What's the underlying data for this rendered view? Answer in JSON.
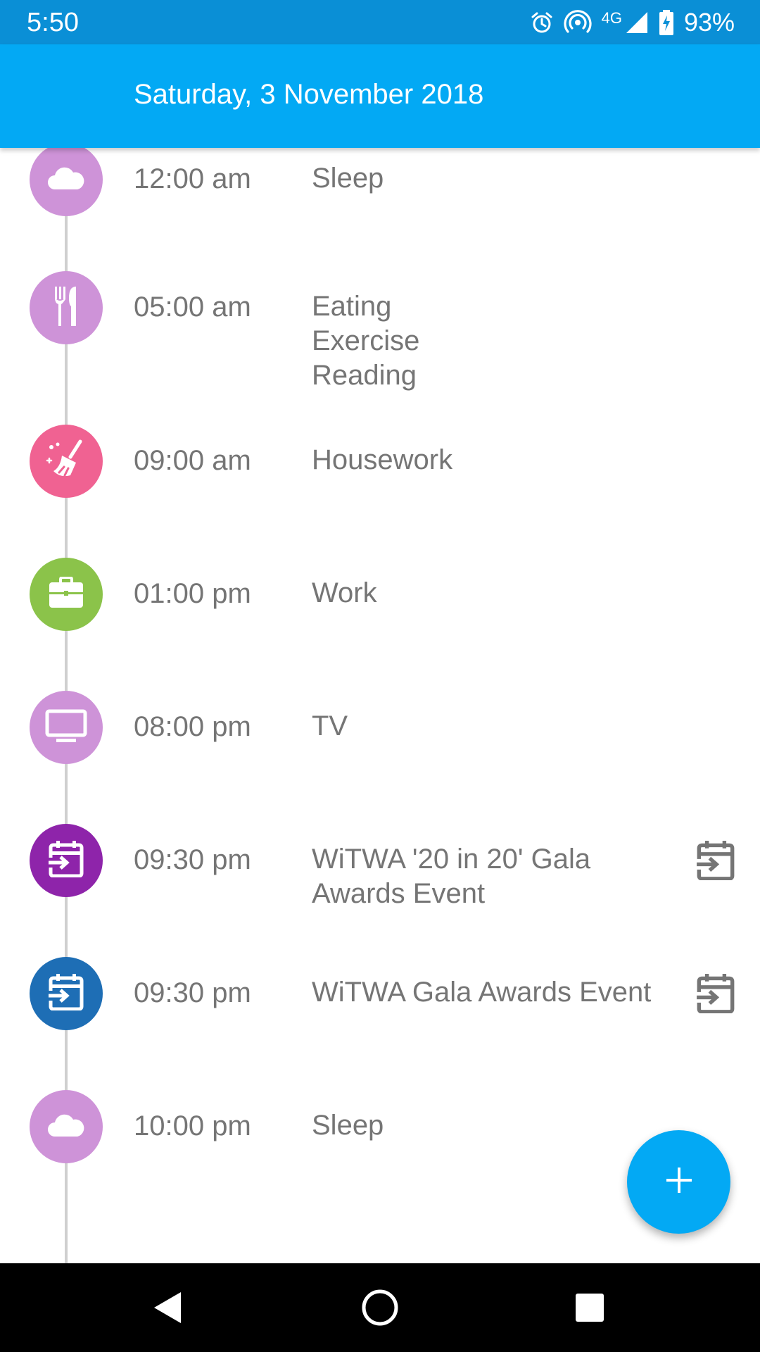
{
  "status_bar": {
    "time": "5:50",
    "network": "4G",
    "battery": "93%",
    "icons": [
      "alarm-icon",
      "hotspot-icon",
      "signal-icon",
      "battery-charging-icon"
    ]
  },
  "app_bar": {
    "title": "Saturday, 3 November 2018",
    "color": "#03a9f4"
  },
  "timeline": {
    "items": [
      {
        "time": "12:00 am",
        "labels": [
          "Sleep"
        ],
        "icon": "cloud-icon",
        "color": "#ce93d8"
      },
      {
        "time": "05:00 am",
        "labels": [
          "Eating",
          "Exercise",
          "Reading"
        ],
        "icon": "fork-knife-icon",
        "color": "#ce93d8"
      },
      {
        "time": "09:00 am",
        "labels": [
          "Housework"
        ],
        "icon": "broom-icon",
        "color": "#f06292"
      },
      {
        "time": "01:00 pm",
        "labels": [
          "Work"
        ],
        "icon": "briefcase-icon",
        "color": "#8bc34a"
      },
      {
        "time": "08:00 pm",
        "labels": [
          "TV"
        ],
        "icon": "tv-icon",
        "color": "#ce93d8"
      },
      {
        "time": "09:30 pm",
        "labels": [
          "WiTWA '20 in 20' Gala",
          "Awards Event"
        ],
        "icon": "calendar-import-icon",
        "color": "#8e24aa",
        "action_icon": "calendar-import-icon"
      },
      {
        "time": "09:30 pm",
        "labels": [
          "WiTWA Gala Awards Event"
        ],
        "icon": "calendar-import-icon",
        "color": "#1e6eb5",
        "action_icon": "calendar-import-icon"
      },
      {
        "time": "10:00 pm",
        "labels": [
          "Sleep"
        ],
        "icon": "cloud-icon",
        "color": "#ce93d8"
      }
    ]
  },
  "fab": {
    "icon": "plus-icon",
    "color": "#03a9f4"
  },
  "nav_bar": {
    "icons": [
      "back-icon",
      "home-icon",
      "recents-icon"
    ]
  }
}
